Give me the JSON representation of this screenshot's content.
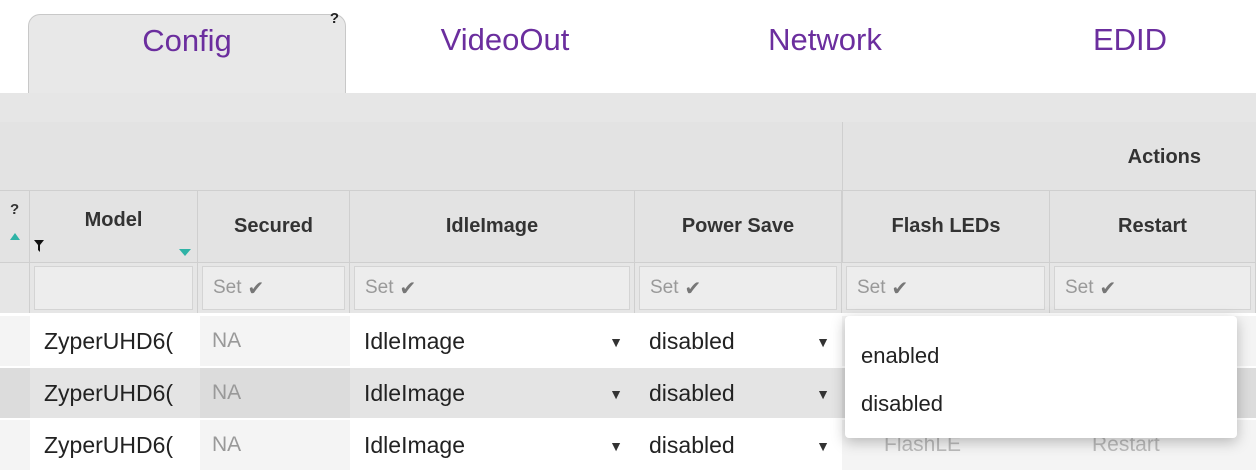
{
  "tabs": [
    {
      "label": "Config",
      "active": true,
      "help": "?"
    },
    {
      "label": "VideoOut"
    },
    {
      "label": "Network"
    },
    {
      "label": "EDID"
    }
  ],
  "header": {
    "group_actions": "Actions",
    "help_mark": "?",
    "columns": {
      "model": "Model",
      "secured": "Secured",
      "idle_image": "IdleImage",
      "power_save": "Power Save",
      "flash_leds": "Flash LEDs",
      "restart": "Restart"
    }
  },
  "filter_row": {
    "set_label": "Set",
    "check_glyph": "✔"
  },
  "rows": [
    {
      "model": "ZyperUHD6(",
      "secured": "NA",
      "idle_image": "IdleImage",
      "power_save": "disabled"
    },
    {
      "model": "ZyperUHD6(",
      "secured": "NA",
      "idle_image": "IdleImage",
      "power_save": "disabled"
    },
    {
      "model": "ZyperUHD6(",
      "secured": "NA",
      "idle_image": "IdleImage",
      "power_save": "disabled",
      "flash_leds": "FlashLE",
      "restart": "Restart"
    }
  ],
  "dropdown": {
    "options": [
      "enabled",
      "disabled"
    ]
  },
  "colors": {
    "tab_text": "#6b2e9e",
    "header_bg": "#e3e3e3",
    "sort_indicator": "#2fb3a6"
  }
}
